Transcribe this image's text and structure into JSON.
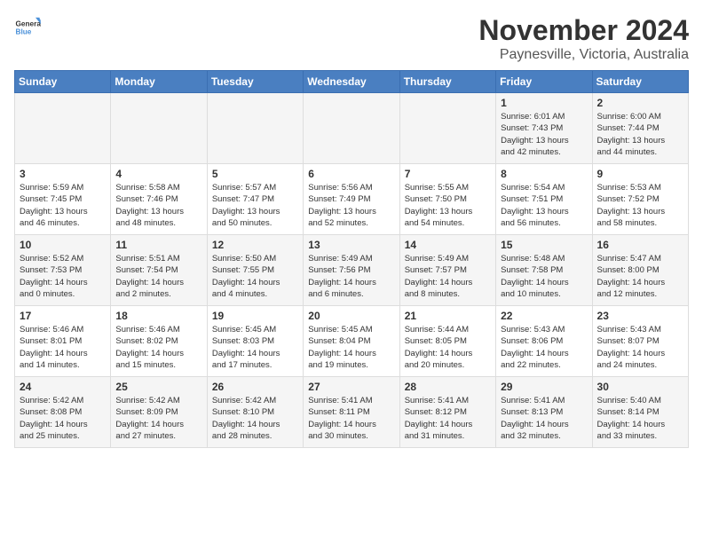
{
  "logo": {
    "general": "General",
    "blue": "Blue"
  },
  "header": {
    "month": "November 2024",
    "location": "Paynesville, Victoria, Australia"
  },
  "weekdays": [
    "Sunday",
    "Monday",
    "Tuesday",
    "Wednesday",
    "Thursday",
    "Friday",
    "Saturday"
  ],
  "weeks": [
    [
      {
        "day": "",
        "info": ""
      },
      {
        "day": "",
        "info": ""
      },
      {
        "day": "",
        "info": ""
      },
      {
        "day": "",
        "info": ""
      },
      {
        "day": "",
        "info": ""
      },
      {
        "day": "1",
        "info": "Sunrise: 6:01 AM\nSunset: 7:43 PM\nDaylight: 13 hours\nand 42 minutes."
      },
      {
        "day": "2",
        "info": "Sunrise: 6:00 AM\nSunset: 7:44 PM\nDaylight: 13 hours\nand 44 minutes."
      }
    ],
    [
      {
        "day": "3",
        "info": "Sunrise: 5:59 AM\nSunset: 7:45 PM\nDaylight: 13 hours\nand 46 minutes."
      },
      {
        "day": "4",
        "info": "Sunrise: 5:58 AM\nSunset: 7:46 PM\nDaylight: 13 hours\nand 48 minutes."
      },
      {
        "day": "5",
        "info": "Sunrise: 5:57 AM\nSunset: 7:47 PM\nDaylight: 13 hours\nand 50 minutes."
      },
      {
        "day": "6",
        "info": "Sunrise: 5:56 AM\nSunset: 7:49 PM\nDaylight: 13 hours\nand 52 minutes."
      },
      {
        "day": "7",
        "info": "Sunrise: 5:55 AM\nSunset: 7:50 PM\nDaylight: 13 hours\nand 54 minutes."
      },
      {
        "day": "8",
        "info": "Sunrise: 5:54 AM\nSunset: 7:51 PM\nDaylight: 13 hours\nand 56 minutes."
      },
      {
        "day": "9",
        "info": "Sunrise: 5:53 AM\nSunset: 7:52 PM\nDaylight: 13 hours\nand 58 minutes."
      }
    ],
    [
      {
        "day": "10",
        "info": "Sunrise: 5:52 AM\nSunset: 7:53 PM\nDaylight: 14 hours\nand 0 minutes."
      },
      {
        "day": "11",
        "info": "Sunrise: 5:51 AM\nSunset: 7:54 PM\nDaylight: 14 hours\nand 2 minutes."
      },
      {
        "day": "12",
        "info": "Sunrise: 5:50 AM\nSunset: 7:55 PM\nDaylight: 14 hours\nand 4 minutes."
      },
      {
        "day": "13",
        "info": "Sunrise: 5:49 AM\nSunset: 7:56 PM\nDaylight: 14 hours\nand 6 minutes."
      },
      {
        "day": "14",
        "info": "Sunrise: 5:49 AM\nSunset: 7:57 PM\nDaylight: 14 hours\nand 8 minutes."
      },
      {
        "day": "15",
        "info": "Sunrise: 5:48 AM\nSunset: 7:58 PM\nDaylight: 14 hours\nand 10 minutes."
      },
      {
        "day": "16",
        "info": "Sunrise: 5:47 AM\nSunset: 8:00 PM\nDaylight: 14 hours\nand 12 minutes."
      }
    ],
    [
      {
        "day": "17",
        "info": "Sunrise: 5:46 AM\nSunset: 8:01 PM\nDaylight: 14 hours\nand 14 minutes."
      },
      {
        "day": "18",
        "info": "Sunrise: 5:46 AM\nSunset: 8:02 PM\nDaylight: 14 hours\nand 15 minutes."
      },
      {
        "day": "19",
        "info": "Sunrise: 5:45 AM\nSunset: 8:03 PM\nDaylight: 14 hours\nand 17 minutes."
      },
      {
        "day": "20",
        "info": "Sunrise: 5:45 AM\nSunset: 8:04 PM\nDaylight: 14 hours\nand 19 minutes."
      },
      {
        "day": "21",
        "info": "Sunrise: 5:44 AM\nSunset: 8:05 PM\nDaylight: 14 hours\nand 20 minutes."
      },
      {
        "day": "22",
        "info": "Sunrise: 5:43 AM\nSunset: 8:06 PM\nDaylight: 14 hours\nand 22 minutes."
      },
      {
        "day": "23",
        "info": "Sunrise: 5:43 AM\nSunset: 8:07 PM\nDaylight: 14 hours\nand 24 minutes."
      }
    ],
    [
      {
        "day": "24",
        "info": "Sunrise: 5:42 AM\nSunset: 8:08 PM\nDaylight: 14 hours\nand 25 minutes."
      },
      {
        "day": "25",
        "info": "Sunrise: 5:42 AM\nSunset: 8:09 PM\nDaylight: 14 hours\nand 27 minutes."
      },
      {
        "day": "26",
        "info": "Sunrise: 5:42 AM\nSunset: 8:10 PM\nDaylight: 14 hours\nand 28 minutes."
      },
      {
        "day": "27",
        "info": "Sunrise: 5:41 AM\nSunset: 8:11 PM\nDaylight: 14 hours\nand 30 minutes."
      },
      {
        "day": "28",
        "info": "Sunrise: 5:41 AM\nSunset: 8:12 PM\nDaylight: 14 hours\nand 31 minutes."
      },
      {
        "day": "29",
        "info": "Sunrise: 5:41 AM\nSunset: 8:13 PM\nDaylight: 14 hours\nand 32 minutes."
      },
      {
        "day": "30",
        "info": "Sunrise: 5:40 AM\nSunset: 8:14 PM\nDaylight: 14 hours\nand 33 minutes."
      }
    ]
  ]
}
